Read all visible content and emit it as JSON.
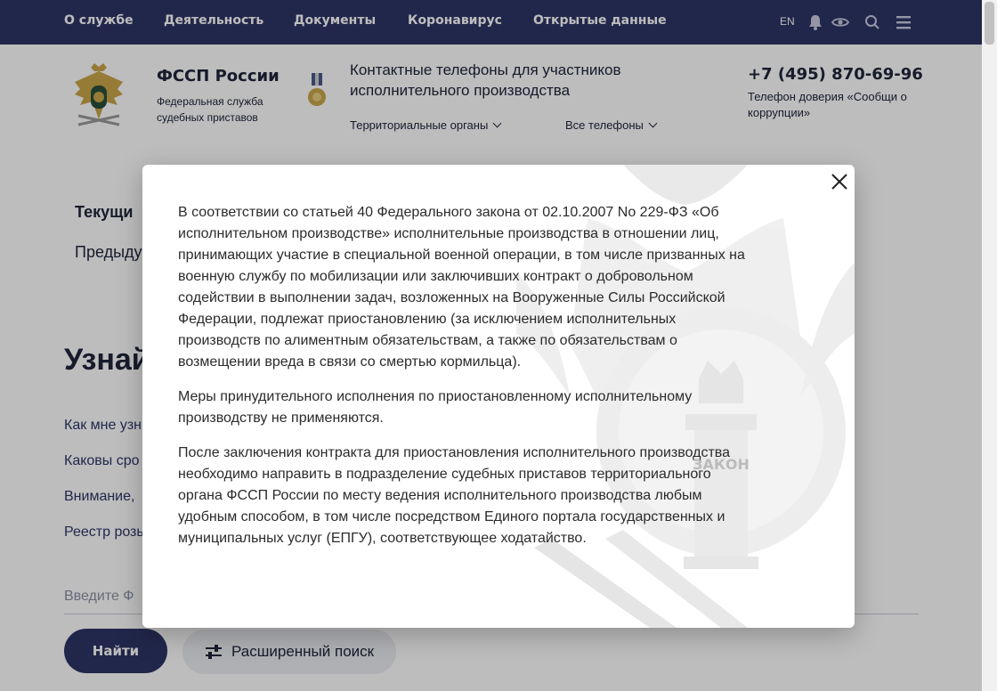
{
  "topnav": {
    "items": [
      "О службе",
      "Деятельность",
      "Документы",
      "Коронавирус",
      "Открытые данные"
    ],
    "lang": "EN",
    "icons": [
      "bell-icon",
      "eye-icon",
      "search-icon",
      "menu-icon"
    ]
  },
  "header": {
    "brand": "ФССП России",
    "brand_sub": "Федеральная служба судебных приставов",
    "contacts_title": "Контактные телефоны для участников исполнительного производства",
    "dropdown_territorial": "Территориальные органы",
    "dropdown_all_phones": "Все телефоны",
    "phone": "+7 (495) 870-69-96",
    "phone_sub": "Телефон доверия «Сообщи о коррупции»"
  },
  "content": {
    "current_label": "Текущи",
    "prev_label": "Предыду",
    "heading": "Узнай",
    "links": [
      "Как мне узн",
      "Каковы сро",
      "Внимание,",
      "Реестр розь"
    ],
    "search_placeholder": "Введите Ф",
    "find_button": "Найти",
    "advanced_search_button": "Расширенный поиск"
  },
  "modal": {
    "paragraphs": [
      "В соответствии со статьей 40 Федерального закона от 02.10.2007 No 229-ФЗ «Об исполнительном производстве» исполнительные производства в отношении лиц, принимающих участие в специальной военной операции, в том числе призванных на военную службу по мобилизации или заключивших контракт о добровольном содействии в выполнении задач, возложенных на Вооруженные Силы Российской Федерации, подлежат приостановлению (за исключением исполнительных производств по алиментным обязательствам, а также по обязательствам о возмещении вреда в связи со смертью кормильца).",
      "Меры принудительного исполнения по приостановленному исполнительному производству не применяются.",
      "После заключения контракта для приостановления исполнительного производства необходимо направить в подразделение судебных приставов территориального органа ФССП России по месту ведения исполнительного производства любым удобным способом, в том числе посредством Единого портала государственных и муниципальных услуг (ЕПГУ), соответствующее ходатайство."
    ],
    "emblem_text": "ЗАКОН"
  },
  "colors": {
    "nav_bg": "#2d3566",
    "text": "#20253a",
    "overlay": "rgba(0,0,0,0.26)"
  }
}
